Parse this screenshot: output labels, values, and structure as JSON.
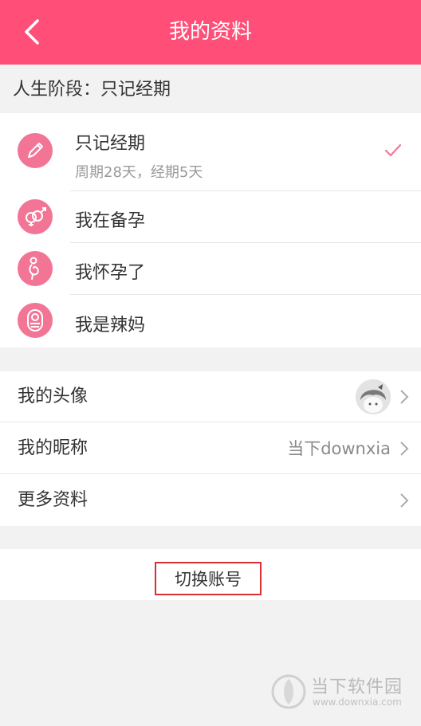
{
  "header": {
    "title": "我的资料",
    "back_icon": "chevron-left-icon",
    "background": "#ff4f78"
  },
  "stage": {
    "section_label": "人生阶段：只记经期",
    "options": [
      {
        "label": "只记经期",
        "sub": "周期28天，经期5天",
        "icon": "pen-icon",
        "selected": true
      },
      {
        "label": "我在备孕",
        "sub": "",
        "icon": "gender-rings-icon",
        "selected": false
      },
      {
        "label": "我怀孕了",
        "sub": "",
        "icon": "pregnant-icon",
        "selected": false
      },
      {
        "label": "我是辣妈",
        "sub": "",
        "icon": "baby-icon",
        "selected": false
      }
    ],
    "accent": "#f37596",
    "check_icon": "checkmark-icon"
  },
  "profile": {
    "avatar_label": "我的头像",
    "nickname_label": "我的昵称",
    "nickname_value": "当下downxia",
    "more_label": "更多资料"
  },
  "actions": {
    "switch_account": "切换账号"
  },
  "watermark": {
    "name": "当下软件园",
    "url": "www.downxia.com"
  }
}
